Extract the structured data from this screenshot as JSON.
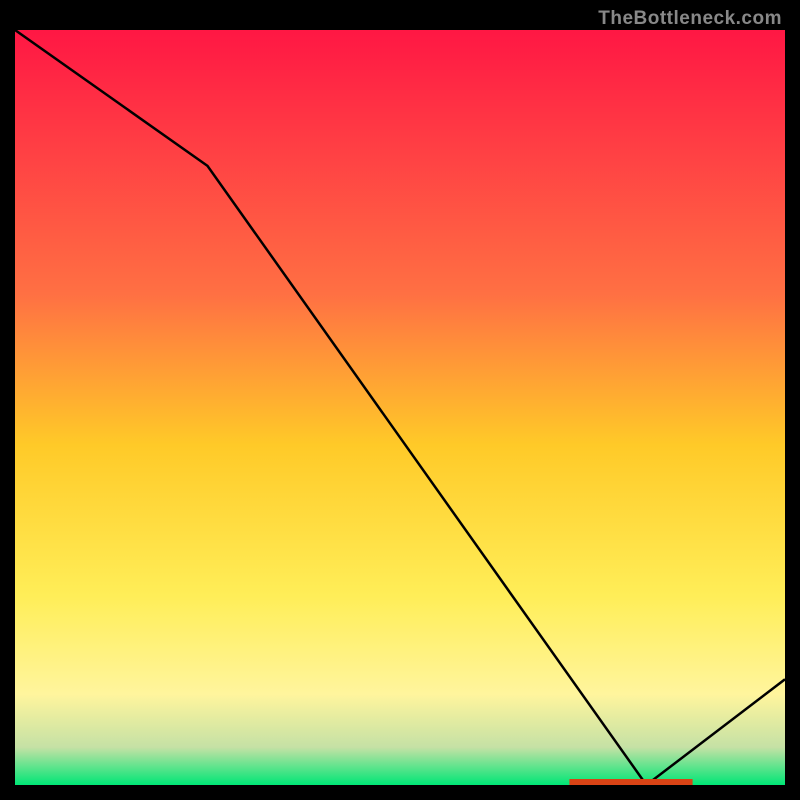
{
  "watermark": "TheBottleneck.com",
  "chart_data": {
    "type": "line",
    "title": "",
    "xlabel": "",
    "ylabel": "",
    "xlim": [
      0,
      100
    ],
    "ylim": [
      0,
      100
    ],
    "x": [
      0,
      25,
      82,
      100
    ],
    "values": [
      100,
      82,
      0,
      14
    ],
    "optimal_marker": {
      "x_start": 72,
      "x_end": 88,
      "y": 0
    },
    "gradient_stops": [
      {
        "offset": 0,
        "color": "#ff1744"
      },
      {
        "offset": 35,
        "color": "#ff7043"
      },
      {
        "offset": 55,
        "color": "#ffca28"
      },
      {
        "offset": 75,
        "color": "#ffee58"
      },
      {
        "offset": 88,
        "color": "#fff59d"
      },
      {
        "offset": 95,
        "color": "#c5e1a5"
      },
      {
        "offset": 100,
        "color": "#00e676"
      }
    ]
  }
}
